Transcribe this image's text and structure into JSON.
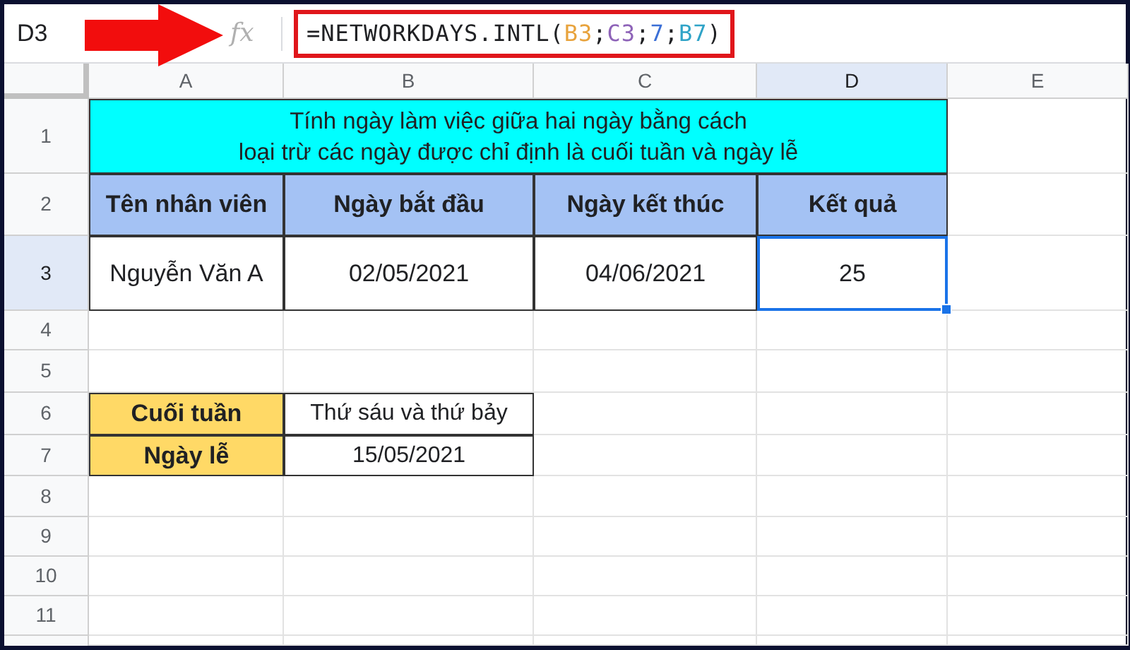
{
  "name_box": "D3",
  "formula_icon": "fx",
  "formula": [
    {
      "text": "=NETWORKDAYS.INTL(",
      "color": "#202124"
    },
    {
      "text": "B3",
      "color": "#e8a33d"
    },
    {
      "text": ";",
      "color": "#202124"
    },
    {
      "text": "C3",
      "color": "#8e63b8"
    },
    {
      "text": ";",
      "color": "#202124"
    },
    {
      "text": "7",
      "color": "#3b6fd6"
    },
    {
      "text": ";",
      "color": "#202124"
    },
    {
      "text": "B7",
      "color": "#2fa3c7"
    },
    {
      "text": ")",
      "color": "#202124"
    }
  ],
  "columns": [
    {
      "label": "A",
      "selected": false
    },
    {
      "label": "B",
      "selected": false
    },
    {
      "label": "C",
      "selected": false
    },
    {
      "label": "D",
      "selected": true
    },
    {
      "label": "E",
      "selected": false
    }
  ],
  "rows": [
    {
      "label": "1",
      "selected": false
    },
    {
      "label": "2",
      "selected": false
    },
    {
      "label": "3",
      "selected": true
    },
    {
      "label": "4",
      "selected": false
    },
    {
      "label": "5",
      "selected": false
    },
    {
      "label": "6",
      "selected": false
    },
    {
      "label": "7",
      "selected": false
    },
    {
      "label": "8",
      "selected": false
    },
    {
      "label": "9",
      "selected": false
    },
    {
      "label": "10",
      "selected": false
    },
    {
      "label": "11",
      "selected": false
    }
  ],
  "title": [
    "Tính ngày làm việc giữa hai ngày bằng cách",
    "loại trừ các ngày được chỉ định là cuối tuần và ngày lễ"
  ],
  "table": {
    "headers": [
      "Tên nhân viên",
      "Ngày bắt đầu",
      "Ngày kết thúc",
      "Kết quả"
    ],
    "cells": [
      {
        "text": "Nguyễn Văn A",
        "selected": false
      },
      {
        "text": "02/05/2021",
        "selected": false
      },
      {
        "text": "04/06/2021",
        "selected": false
      },
      {
        "text": "25",
        "selected": true
      }
    ]
  },
  "info": [
    {
      "label": "Cuối tuần",
      "value": "Thứ sáu và thứ bảy"
    },
    {
      "label": "Ngày lễ",
      "value": "15/05/2021"
    }
  ]
}
